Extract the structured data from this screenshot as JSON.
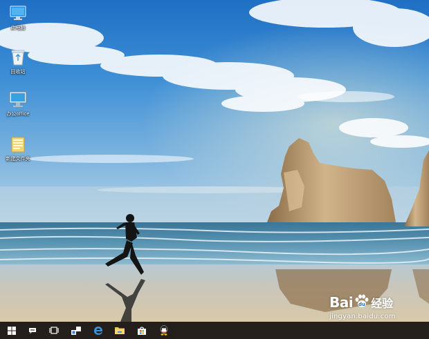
{
  "desktop": {
    "icons": [
      {
        "label": "此电脑",
        "icon": "computer-icon"
      },
      {
        "label": "回收站",
        "icon": "recycle-bin-icon"
      },
      {
        "label": "办公office",
        "icon": "monitor-icon"
      },
      {
        "label": "新建文件夹",
        "icon": "folder-icon"
      }
    ]
  },
  "taskbar": {
    "buttons": [
      {
        "icon": "windows-start-icon"
      },
      {
        "icon": "cortana-search-icon"
      },
      {
        "icon": "task-view-icon"
      },
      {
        "icon": "people-app-icon"
      },
      {
        "icon": "edge-browser-icon"
      },
      {
        "icon": "file-explorer-icon"
      },
      {
        "icon": "store-icon"
      },
      {
        "icon": "qq-icon"
      }
    ]
  },
  "watermark": {
    "brand": "Bai",
    "brand_suffix": "经验",
    "url": "jingyan.baidu.com"
  },
  "colors": {
    "sky_top": "#2b78c8",
    "sky_horizon": "#a9c9dd",
    "sea": "#3f7fa6",
    "sand": "#c7c0b0",
    "rock": "#b99c72",
    "taskbar": "#1a1410"
  }
}
